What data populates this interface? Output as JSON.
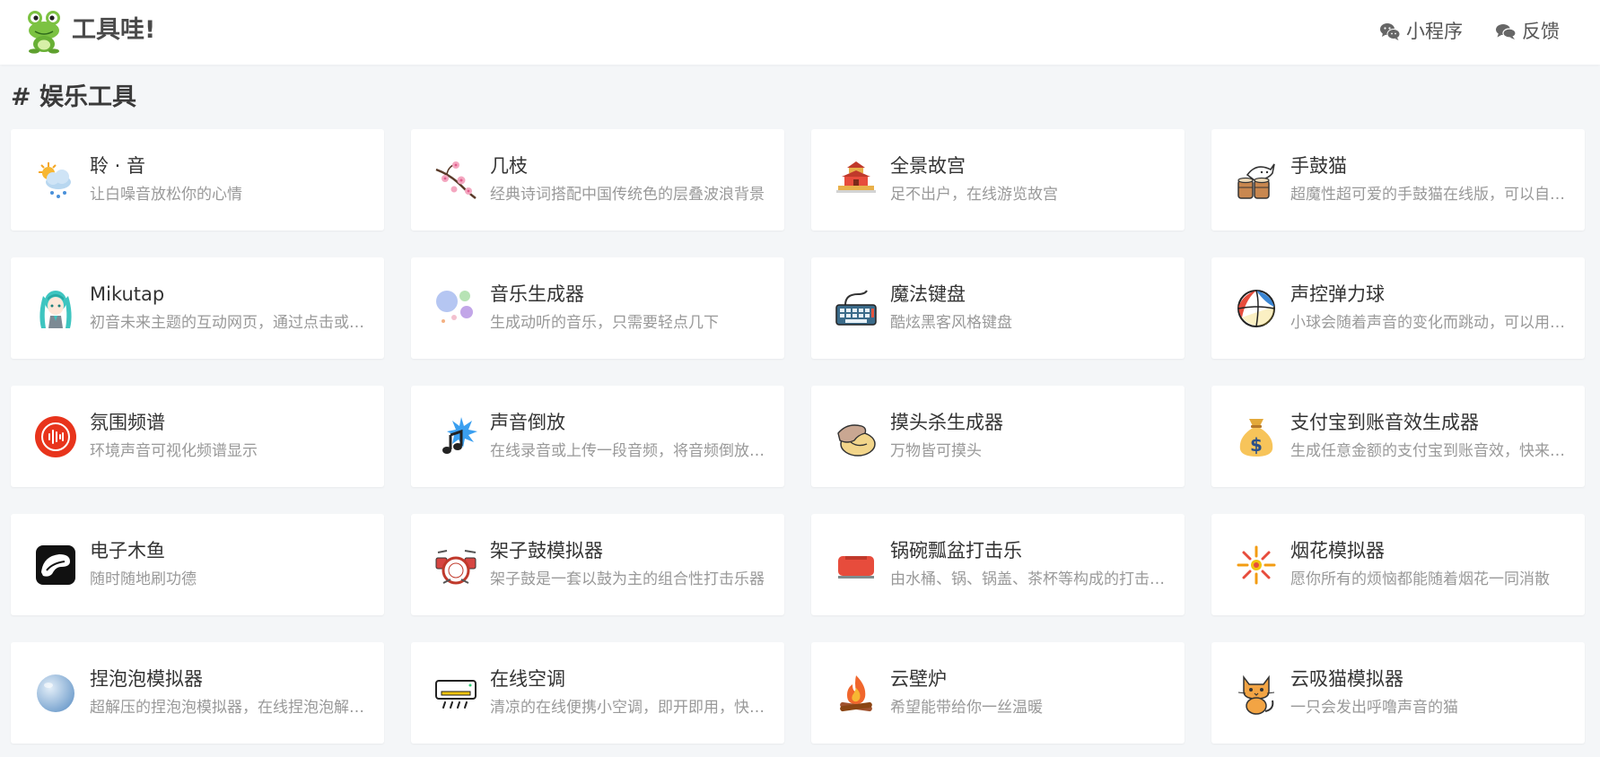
{
  "header": {
    "brand": "工具哇!",
    "nav": [
      {
        "label": "小程序",
        "icon": "wechat-icon"
      },
      {
        "label": "反馈",
        "icon": "comments-icon"
      }
    ]
  },
  "section": {
    "title": "# 娱乐工具"
  },
  "tools": [
    {
      "title": "聆 · 音",
      "desc": "让白噪音放松你的心情",
      "icon": "weather-cloud-sun-rain-icon"
    },
    {
      "title": "几枝",
      "desc": "经典诗词搭配中国传统色的层叠波浪背景",
      "icon": "cherry-blossom-branch-icon"
    },
    {
      "title": "全景故宫",
      "desc": "足不出户，在线游览故宫",
      "icon": "forbidden-city-icon"
    },
    {
      "title": "手鼓猫",
      "desc": "超魔性超可爱的手鼓猫在线版，可以自由发挥",
      "icon": "bongo-cat-icon"
    },
    {
      "title": "Mikutap",
      "desc": "初音未来主题的互动网页，通过点击或敲击键盘演奏",
      "icon": "miku-icon"
    },
    {
      "title": "音乐生成器",
      "desc": "生成动听的音乐，只需要轻点几下",
      "icon": "music-bubbles-icon"
    },
    {
      "title": "魔法键盘",
      "desc": "酷炫黑客风格键盘",
      "icon": "keyboard-icon"
    },
    {
      "title": "声控弹力球",
      "desc": "小球会随着声音的变化而跳动，可以用来测试声音",
      "icon": "beach-ball-icon"
    },
    {
      "title": "氛围频谱",
      "desc": "环境声音可视化频谱显示",
      "icon": "audio-spectrum-icon"
    },
    {
      "title": "声音倒放",
      "desc": "在线录音或上传一段音频，将音频倒放播放",
      "icon": "music-note-burst-icon"
    },
    {
      "title": "摸头杀生成器",
      "desc": "万物皆可摸头",
      "icon": "pat-hand-icon"
    },
    {
      "title": "支付宝到账音效生成器",
      "desc": "生成任意金额的支付宝到账音效，快来试试吧",
      "icon": "money-bag-icon"
    },
    {
      "title": "电子木鱼",
      "desc": "随时随地刷功德",
      "icon": "wooden-fish-icon"
    },
    {
      "title": "架子鼓模拟器",
      "desc": "架子鼓是一套以鼓为主的组合性打击乐器",
      "icon": "drum-kit-icon"
    },
    {
      "title": "锅碗瓢盆打击乐",
      "desc": "由水桶、锅、锅盖、茶杯等构成的打击乐器",
      "icon": "toaster-icon"
    },
    {
      "title": "烟花模拟器",
      "desc": "愿你所有的烦恼都能随着烟花一同消散",
      "icon": "firework-icon"
    },
    {
      "title": "捏泡泡模拟器",
      "desc": "超解压的捏泡泡模拟器，在线捏泡泡解压神器",
      "icon": "bubble-icon"
    },
    {
      "title": "在线空调",
      "desc": "清凉的在线便携小空调，即开即用，快来体验",
      "icon": "air-conditioner-icon"
    },
    {
      "title": "云壁炉",
      "desc": "希望能带给你一丝温暖",
      "icon": "campfire-icon"
    },
    {
      "title": "云吸猫模拟器",
      "desc": "一只会发出呼噜声音的猫",
      "icon": "cat-icon"
    }
  ]
}
